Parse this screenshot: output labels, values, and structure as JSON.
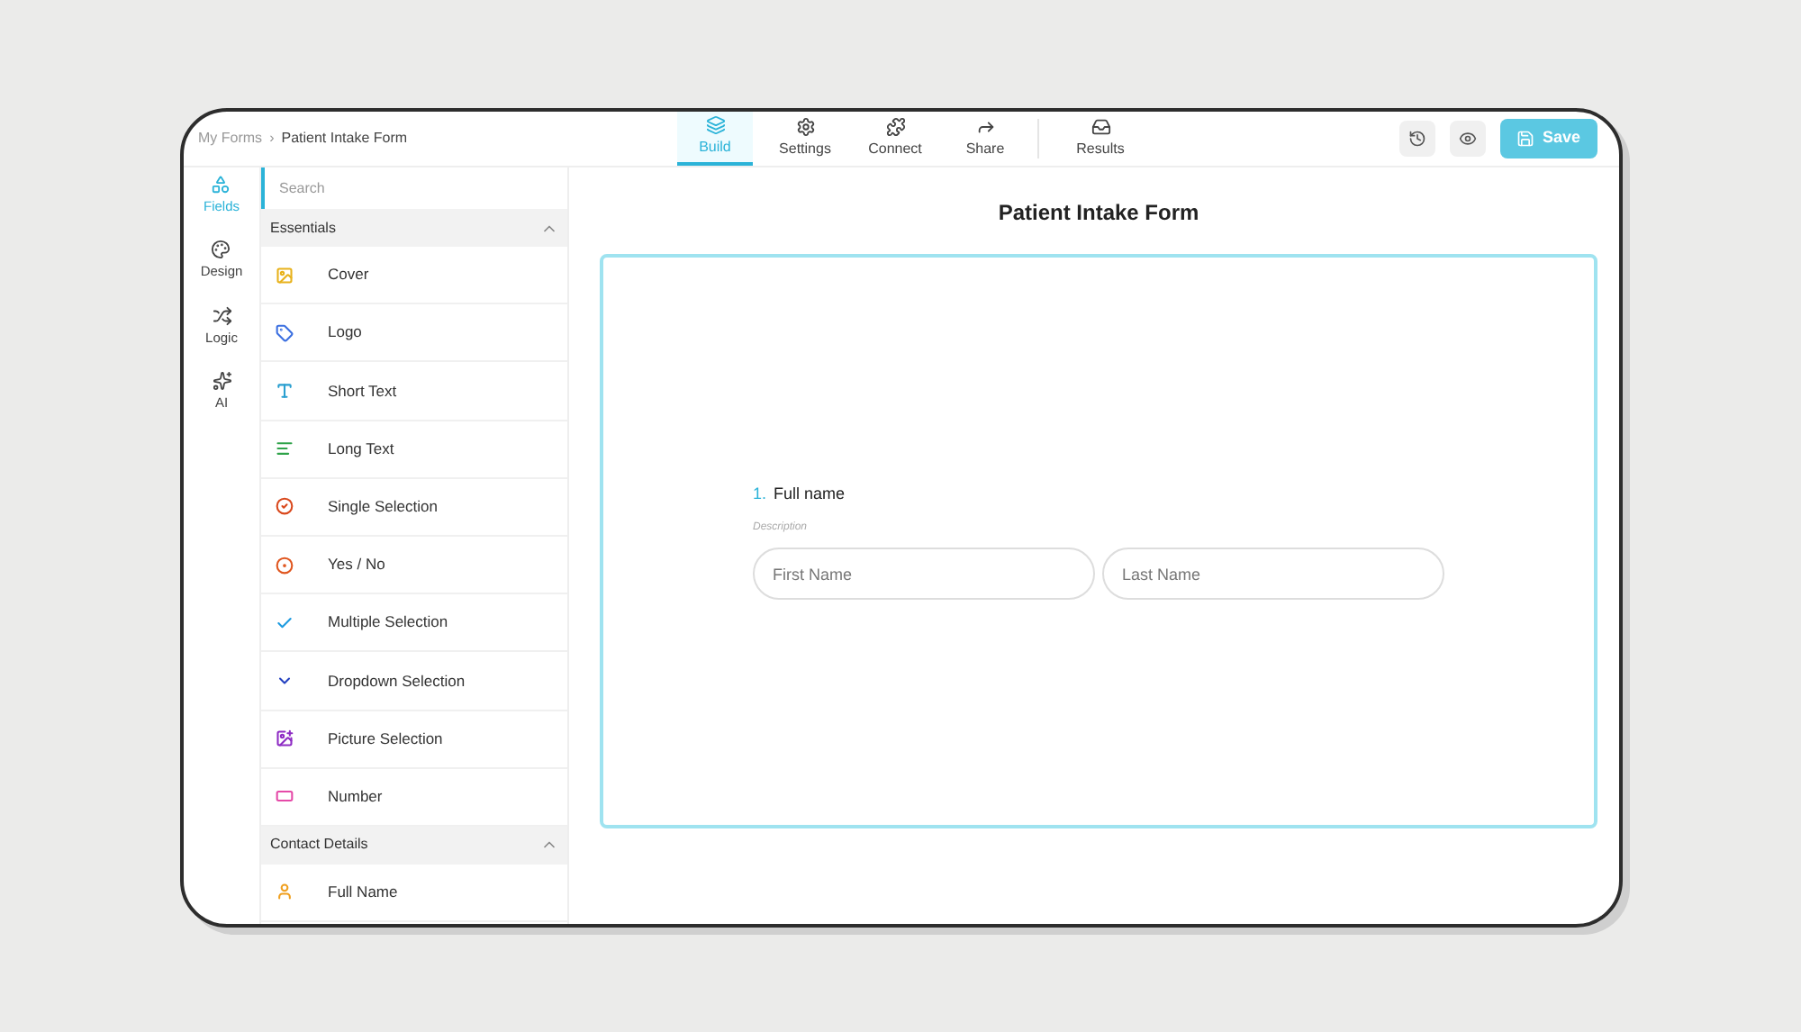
{
  "breadcrumb": {
    "parent": "My Forms",
    "separator": "›",
    "current": "Patient Intake Form"
  },
  "tabs": [
    {
      "label": "Build",
      "kind": "layers",
      "selected": true
    },
    {
      "label": "Settings",
      "kind": "gear",
      "selected": false
    },
    {
      "label": "Connect",
      "kind": "puzzle",
      "selected": false
    },
    {
      "label": "Share",
      "kind": "share",
      "selected": false
    },
    {
      "label": "Results",
      "kind": "inbox",
      "selected": false
    }
  ],
  "actions": {
    "save": "Save"
  },
  "sidebar": {
    "items": [
      {
        "label": "Fields",
        "kind": "shapes",
        "selected": true
      },
      {
        "label": "Design",
        "kind": "palette",
        "selected": false
      },
      {
        "label": "Logic",
        "kind": "shuffle",
        "selected": false
      },
      {
        "label": "AI",
        "kind": "sparkles",
        "selected": false
      }
    ]
  },
  "fields_panel": {
    "search": {
      "placeholder": "Search"
    },
    "sections": [
      {
        "title": "Essentials",
        "expanded": true,
        "items": [
          {
            "label": "Cover",
            "kind": "cover"
          },
          {
            "label": "Logo",
            "kind": "logo"
          },
          {
            "label": "Short Text",
            "kind": "short_text"
          },
          {
            "label": "Long Text",
            "kind": "long_text"
          },
          {
            "label": "Single Selection",
            "kind": "single"
          },
          {
            "label": "Yes / No",
            "kind": "yesno"
          },
          {
            "label": "Multiple Selection",
            "kind": "multiple"
          },
          {
            "label": "Dropdown Selection",
            "kind": "dropdown"
          },
          {
            "label": "Picture Selection",
            "kind": "picture"
          },
          {
            "label": "Number",
            "kind": "number"
          }
        ]
      },
      {
        "title": "Contact Details",
        "expanded": true,
        "items": [
          {
            "label": "Full Name",
            "kind": "person"
          }
        ]
      }
    ]
  },
  "form": {
    "title": "Patient Intake Form",
    "question": {
      "number": "1.",
      "label": "Full name",
      "description": "Description",
      "inputs": [
        {
          "placeholder": "First Name"
        },
        {
          "placeholder": "Last Name"
        }
      ]
    }
  }
}
